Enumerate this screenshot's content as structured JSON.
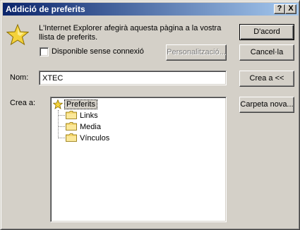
{
  "dialog": {
    "title": "Addició de preferits",
    "help_button": "?",
    "close_button": "X"
  },
  "message": {
    "line1": "L'Internet Explorer afegirà aquesta pàgina a la vostra",
    "line2": "llista de preferits."
  },
  "offline_checkbox": {
    "label": "Disponible sense connexió",
    "checked": false
  },
  "buttons": {
    "ok": "D'acord",
    "cancel": "Cancel·la",
    "customize": "Personalització...",
    "create_in": "Crea a <<",
    "new_folder": "Carpeta nova..."
  },
  "name_field": {
    "label": "Nom:",
    "value": "XTEC"
  },
  "create_in": {
    "label": "Crea a:",
    "tree": {
      "root": "Preferits",
      "children": [
        "Links",
        "Media",
        "Vínculos"
      ]
    }
  },
  "colors": {
    "title_gradient_start": "#0a246a",
    "title_gradient_end": "#a6caf0",
    "dialog_face": "#d4d0c8",
    "star": "#f4d23a",
    "folder": "#f5d76e"
  }
}
